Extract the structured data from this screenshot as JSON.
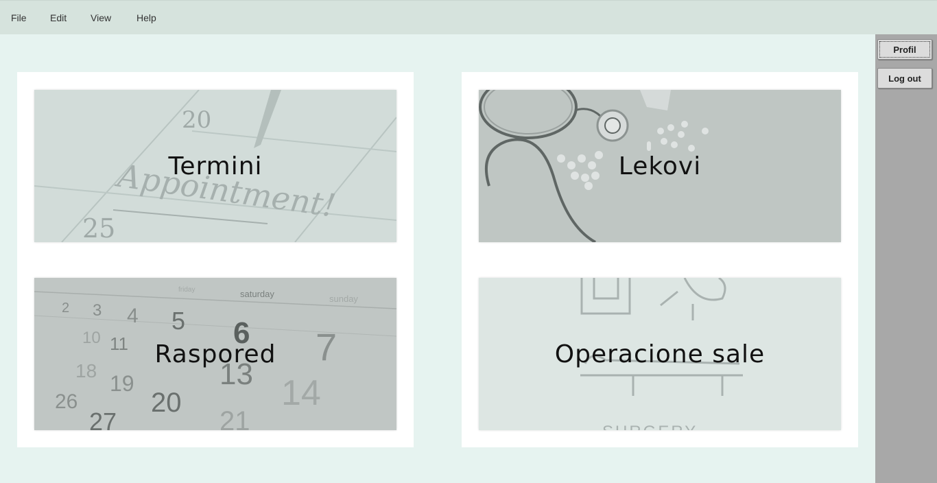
{
  "menu": {
    "file": "File",
    "edit": "Edit",
    "view": "View",
    "help": "Help"
  },
  "sidebar": {
    "profile_label": "Profil",
    "logout_label": "Log out"
  },
  "tiles": {
    "appointments": {
      "label": "Termini",
      "image_text": "Appointment!",
      "num_top": "20",
      "num_bottom": "25"
    },
    "medicines": {
      "label": "Lekovi"
    },
    "schedule": {
      "label": "Raspored",
      "day_a": "saturday",
      "day_b": "sunday",
      "day_c": "friday"
    },
    "operating_rooms": {
      "label": "Operacione sale",
      "image_text": "SURGERY"
    }
  }
}
